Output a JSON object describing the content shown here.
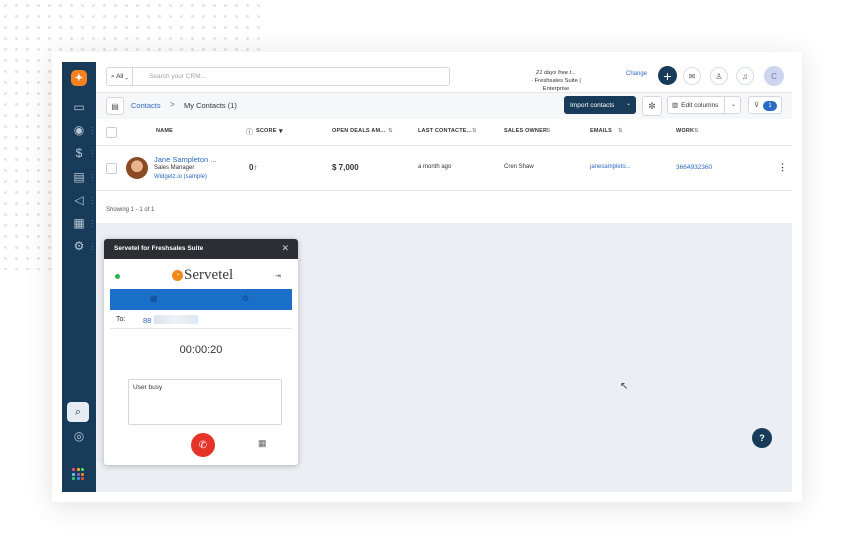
{
  "topbar": {
    "search_scope": "All",
    "search_placeholder": "Search your CRM...",
    "trial_line1": "21 days free t...",
    "trial_line2": "· Freshsales Suite |",
    "trial_line3": "Enterprise",
    "change_label": "Change",
    "avatar_initial": "C"
  },
  "toolbar": {
    "breadcrumb_root": "Contacts",
    "breadcrumb_sep": ">",
    "breadcrumb_current": "My Contacts (1)",
    "import_label": "Import contacts",
    "edit_columns_label": "Edit columns",
    "filter_count": "1"
  },
  "table": {
    "columns": {
      "name": "NAME",
      "score": "SCORE",
      "open_deals": "OPEN DEALS AM...",
      "last_contacted": "LAST CONTACTE...",
      "sales_owner": "SALES OWNER",
      "emails": "EMAILS",
      "work": "WORK"
    },
    "row": {
      "name": "Jane Sampleton ...",
      "title": "Sales Manager",
      "company": "Widgetz.io (sample)",
      "score": "0",
      "open_deals": "$ 7,000",
      "last_contacted": "a month ago",
      "sales_owner": "Cren Shaw",
      "email": "janesampleto...",
      "work": "3664932360"
    },
    "footer": "Showing 1 - 1 of 1"
  },
  "dialer": {
    "title": "Servetel for Freshsales Suite",
    "brand": "Servetel",
    "to_label": "To:",
    "to_value": "88",
    "timer": "00:00:20",
    "note": "User busy"
  },
  "help_label": "?",
  "colors": {
    "sidebar": "#173b59",
    "accent_blue": "#2b6ac4",
    "dialer_bar": "#1a6fc9",
    "hangup_red": "#e5332a",
    "logo_orange": "#f5821f"
  },
  "icons": {
    "sidebar": [
      "dashboard-icon",
      "contacts-icon",
      "deals-icon",
      "conversations-icon",
      "campaigns-icon",
      "reports-icon",
      "settings-icon"
    ],
    "topbar": [
      "plus-icon",
      "mail-icon",
      "bell-outline-icon",
      "notification-icon"
    ]
  }
}
